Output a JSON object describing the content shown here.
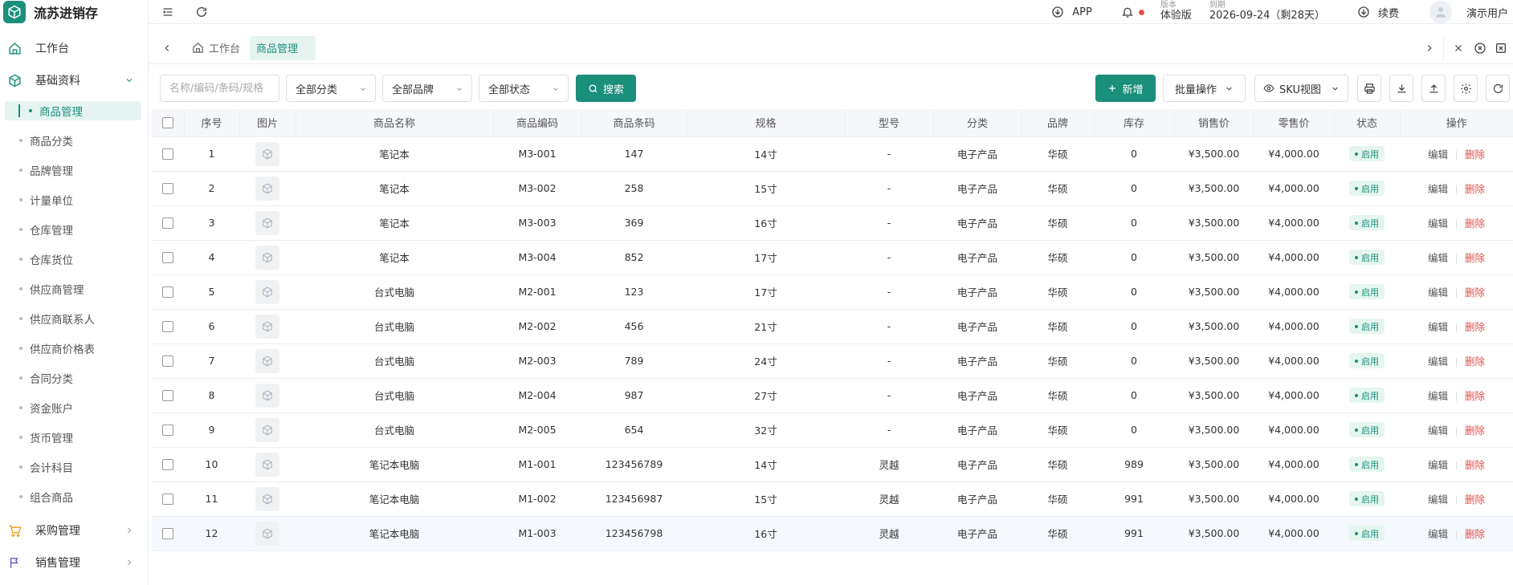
{
  "app": {
    "title": "流苏进销存"
  },
  "header": {
    "app_download": "APP",
    "version_label": "版本",
    "version_value": "体验版",
    "expire_label": "到期",
    "expire_value": "2026-09-24（剩28天）",
    "renew_label": "续费",
    "user_name": "演示用户"
  },
  "sidebar": {
    "workbench": "工作台",
    "basic_group": "基础资料",
    "basic_items": [
      "商品管理",
      "商品分类",
      "品牌管理",
      "计量单位",
      "仓库管理",
      "仓库货位",
      "供应商管理",
      "供应商联系人",
      "供应商价格表",
      "合同分类",
      "资金账户",
      "货币管理",
      "会计科目",
      "组合商品"
    ],
    "purchase_group": "采购管理",
    "sales_group": "销售管理"
  },
  "tabs": [
    "工作台",
    "商品管理"
  ],
  "toolbar": {
    "search_placeholder": "名称/编码/条码/规格",
    "category_select": "全部分类",
    "brand_select": "全部品牌",
    "status_select": "全部状态",
    "search_btn": "搜索",
    "add_btn": "新增",
    "batch_btn": "批量操作",
    "sku_btn": "SKU视图"
  },
  "table": {
    "headers": [
      "序号",
      "图片",
      "商品名称",
      "商品编码",
      "商品条码",
      "规格",
      "型号",
      "分类",
      "品牌",
      "库存",
      "销售价",
      "零售价",
      "状态",
      "操作"
    ],
    "edit_label": "编辑",
    "delete_label": "删除",
    "rows": [
      {
        "no": "1",
        "name": "笔记本",
        "code": "M3-001",
        "barcode": "147",
        "spec": "14寸",
        "model": "-",
        "category": "电子产品",
        "brand": "华硕",
        "stock": "0",
        "sale": "¥3,500.00",
        "retail": "¥4,000.00",
        "status": "启用"
      },
      {
        "no": "2",
        "name": "笔记本",
        "code": "M3-002",
        "barcode": "258",
        "spec": "15寸",
        "model": "-",
        "category": "电子产品",
        "brand": "华硕",
        "stock": "0",
        "sale": "¥3,500.00",
        "retail": "¥4,000.00",
        "status": "启用"
      },
      {
        "no": "3",
        "name": "笔记本",
        "code": "M3-003",
        "barcode": "369",
        "spec": "16寸",
        "model": "-",
        "category": "电子产品",
        "brand": "华硕",
        "stock": "0",
        "sale": "¥3,500.00",
        "retail": "¥4,000.00",
        "status": "启用"
      },
      {
        "no": "4",
        "name": "笔记本",
        "code": "M3-004",
        "barcode": "852",
        "spec": "17寸",
        "model": "-",
        "category": "电子产品",
        "brand": "华硕",
        "stock": "0",
        "sale": "¥3,500.00",
        "retail": "¥4,000.00",
        "status": "启用"
      },
      {
        "no": "5",
        "name": "台式电脑",
        "code": "M2-001",
        "barcode": "123",
        "spec": "17寸",
        "model": "-",
        "category": "电子产品",
        "brand": "华硕",
        "stock": "0",
        "sale": "¥3,500.00",
        "retail": "¥4,000.00",
        "status": "启用"
      },
      {
        "no": "6",
        "name": "台式电脑",
        "code": "M2-002",
        "barcode": "456",
        "spec": "21寸",
        "model": "-",
        "category": "电子产品",
        "brand": "华硕",
        "stock": "0",
        "sale": "¥3,500.00",
        "retail": "¥4,000.00",
        "status": "启用"
      },
      {
        "no": "7",
        "name": "台式电脑",
        "code": "M2-003",
        "barcode": "789",
        "spec": "24寸",
        "model": "-",
        "category": "电子产品",
        "brand": "华硕",
        "stock": "0",
        "sale": "¥3,500.00",
        "retail": "¥4,000.00",
        "status": "启用"
      },
      {
        "no": "8",
        "name": "台式电脑",
        "code": "M2-004",
        "barcode": "987",
        "spec": "27寸",
        "model": "-",
        "category": "电子产品",
        "brand": "华硕",
        "stock": "0",
        "sale": "¥3,500.00",
        "retail": "¥4,000.00",
        "status": "启用"
      },
      {
        "no": "9",
        "name": "台式电脑",
        "code": "M2-005",
        "barcode": "654",
        "spec": "32寸",
        "model": "-",
        "category": "电子产品",
        "brand": "华硕",
        "stock": "0",
        "sale": "¥3,500.00",
        "retail": "¥4,000.00",
        "status": "启用"
      },
      {
        "no": "10",
        "name": "笔记本电脑",
        "code": "M1-001",
        "barcode": "123456789",
        "spec": "14寸",
        "model": "灵越",
        "category": "电子产品",
        "brand": "华硕",
        "stock": "989",
        "sale": "¥3,500.00",
        "retail": "¥4,000.00",
        "status": "启用"
      },
      {
        "no": "11",
        "name": "笔记本电脑",
        "code": "M1-002",
        "barcode": "123456987",
        "spec": "15寸",
        "model": "灵越",
        "category": "电子产品",
        "brand": "华硕",
        "stock": "991",
        "sale": "¥3,500.00",
        "retail": "¥4,000.00",
        "status": "启用"
      },
      {
        "no": "12",
        "name": "笔记本电脑",
        "code": "M1-003",
        "barcode": "123456798",
        "spec": "16寸",
        "model": "灵越",
        "category": "电子产品",
        "brand": "华硕",
        "stock": "991",
        "sale": "¥3,500.00",
        "retail": "¥4,000.00",
        "status": "启用"
      }
    ]
  },
  "colors": {
    "primary": "#1a8f7a",
    "danger": "#e0504a",
    "active_bg": "#e6f4f1"
  }
}
